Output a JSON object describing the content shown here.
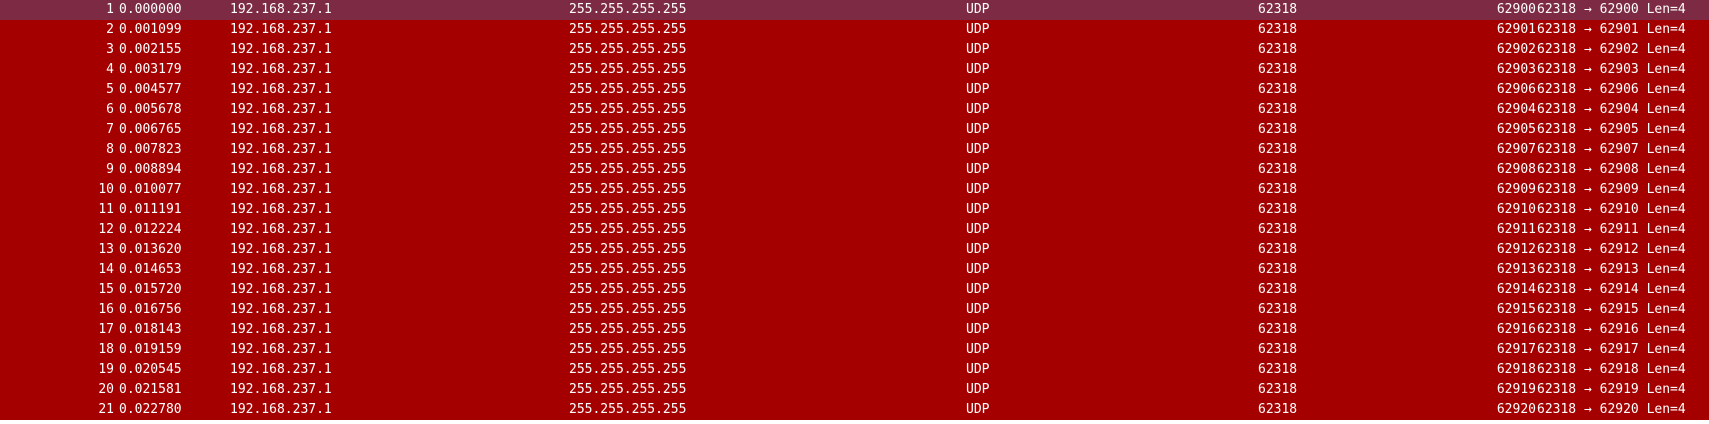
{
  "packets": [
    {
      "no": "1",
      "time": "0.000000",
      "source": "192.168.237.1",
      "destination": "255.255.255.255",
      "protocol": "UDP",
      "src_port": "62318",
      "dst_port": "62900",
      "info": "62318 → 62900 Len=4"
    },
    {
      "no": "2",
      "time": "0.001099",
      "source": "192.168.237.1",
      "destination": "255.255.255.255",
      "protocol": "UDP",
      "src_port": "62318",
      "dst_port": "62901",
      "info": "62318 → 62901 Len=4"
    },
    {
      "no": "3",
      "time": "0.002155",
      "source": "192.168.237.1",
      "destination": "255.255.255.255",
      "protocol": "UDP",
      "src_port": "62318",
      "dst_port": "62902",
      "info": "62318 → 62902 Len=4"
    },
    {
      "no": "4",
      "time": "0.003179",
      "source": "192.168.237.1",
      "destination": "255.255.255.255",
      "protocol": "UDP",
      "src_port": "62318",
      "dst_port": "62903",
      "info": "62318 → 62903 Len=4"
    },
    {
      "no": "5",
      "time": "0.004577",
      "source": "192.168.237.1",
      "destination": "255.255.255.255",
      "protocol": "UDP",
      "src_port": "62318",
      "dst_port": "62906",
      "info": "62318 → 62906 Len=4"
    },
    {
      "no": "6",
      "time": "0.005678",
      "source": "192.168.237.1",
      "destination": "255.255.255.255",
      "protocol": "UDP",
      "src_port": "62318",
      "dst_port": "62904",
      "info": "62318 → 62904 Len=4"
    },
    {
      "no": "7",
      "time": "0.006765",
      "source": "192.168.237.1",
      "destination": "255.255.255.255",
      "protocol": "UDP",
      "src_port": "62318",
      "dst_port": "62905",
      "info": "62318 → 62905 Len=4"
    },
    {
      "no": "8",
      "time": "0.007823",
      "source": "192.168.237.1",
      "destination": "255.255.255.255",
      "protocol": "UDP",
      "src_port": "62318",
      "dst_port": "62907",
      "info": "62318 → 62907 Len=4"
    },
    {
      "no": "9",
      "time": "0.008894",
      "source": "192.168.237.1",
      "destination": "255.255.255.255",
      "protocol": "UDP",
      "src_port": "62318",
      "dst_port": "62908",
      "info": "62318 → 62908 Len=4"
    },
    {
      "no": "10",
      "time": "0.010077",
      "source": "192.168.237.1",
      "destination": "255.255.255.255",
      "protocol": "UDP",
      "src_port": "62318",
      "dst_port": "62909",
      "info": "62318 → 62909 Len=4"
    },
    {
      "no": "11",
      "time": "0.011191",
      "source": "192.168.237.1",
      "destination": "255.255.255.255",
      "protocol": "UDP",
      "src_port": "62318",
      "dst_port": "62910",
      "info": "62318 → 62910 Len=4"
    },
    {
      "no": "12",
      "time": "0.012224",
      "source": "192.168.237.1",
      "destination": "255.255.255.255",
      "protocol": "UDP",
      "src_port": "62318",
      "dst_port": "62911",
      "info": "62318 → 62911 Len=4"
    },
    {
      "no": "13",
      "time": "0.013620",
      "source": "192.168.237.1",
      "destination": "255.255.255.255",
      "protocol": "UDP",
      "src_port": "62318",
      "dst_port": "62912",
      "info": "62318 → 62912 Len=4"
    },
    {
      "no": "14",
      "time": "0.014653",
      "source": "192.168.237.1",
      "destination": "255.255.255.255",
      "protocol": "UDP",
      "src_port": "62318",
      "dst_port": "62913",
      "info": "62318 → 62913 Len=4"
    },
    {
      "no": "15",
      "time": "0.015720",
      "source": "192.168.237.1",
      "destination": "255.255.255.255",
      "protocol": "UDP",
      "src_port": "62318",
      "dst_port": "62914",
      "info": "62318 → 62914 Len=4"
    },
    {
      "no": "16",
      "time": "0.016756",
      "source": "192.168.237.1",
      "destination": "255.255.255.255",
      "protocol": "UDP",
      "src_port": "62318",
      "dst_port": "62915",
      "info": "62318 → 62915 Len=4"
    },
    {
      "no": "17",
      "time": "0.018143",
      "source": "192.168.237.1",
      "destination": "255.255.255.255",
      "protocol": "UDP",
      "src_port": "62318",
      "dst_port": "62916",
      "info": "62318 → 62916 Len=4"
    },
    {
      "no": "18",
      "time": "0.019159",
      "source": "192.168.237.1",
      "destination": "255.255.255.255",
      "protocol": "UDP",
      "src_port": "62318",
      "dst_port": "62917",
      "info": "62318 → 62917 Len=4"
    },
    {
      "no": "19",
      "time": "0.020545",
      "source": "192.168.237.1",
      "destination": "255.255.255.255",
      "protocol": "UDP",
      "src_port": "62318",
      "dst_port": "62918",
      "info": "62318 → 62918 Len=4"
    },
    {
      "no": "20",
      "time": "0.021581",
      "source": "192.168.237.1",
      "destination": "255.255.255.255",
      "protocol": "UDP",
      "src_port": "62318",
      "dst_port": "62919",
      "info": "62318 → 62919 Len=4"
    },
    {
      "no": "21",
      "time": "0.022780",
      "source": "192.168.237.1",
      "destination": "255.255.255.255",
      "protocol": "UDP",
      "src_port": "62318",
      "dst_port": "62920",
      "info": "62318 → 62920 Len=4"
    }
  ],
  "selected_row": 1,
  "colors": {
    "row_background": "#a40000",
    "selected_background": "#7d2a44",
    "text": "#ffffff"
  }
}
